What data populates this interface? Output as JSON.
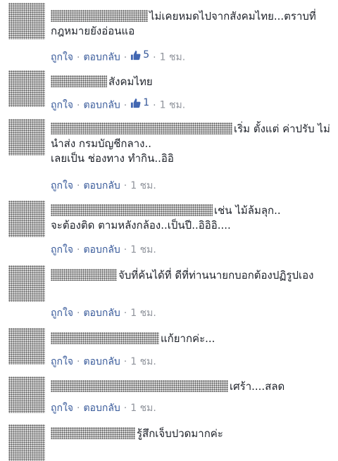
{
  "actions": {
    "like": "ถูกใจ",
    "reply": "ตอบกลับ",
    "separator": "·"
  },
  "comments": [
    {
      "text": "ไม่เคยหมดไปจากสังคมไทย...ตราบที่กฎหมายยังอ่อนแอ",
      "likes": "5",
      "time": "1 ชม."
    },
    {
      "text": "สังคมไทย",
      "likes": "1",
      "time": "1 ชม."
    },
    {
      "text": "เริ่ม ตั้งแต่ ค่าปรับ ไม่นำส่ง กรมบัญชีกลาง..\nเลยเป็น ช่องทาง ทำกิน..อิอิ",
      "likes": "",
      "time": "1 ชม."
    },
    {
      "text": "เช่น ไม้ล้มลุก..\nจะต้องติด ตามหลังกล้อง..เป็นปี..อิอิอิ....",
      "likes": "",
      "time": "1 ชม."
    },
    {
      "text": "จับที่ค้นได้ที่ ดีที่ท่านนายกบอกต้องปฏิรูปเอง",
      "likes": "",
      "time": "1 ชม."
    },
    {
      "text": "แก้ยากค่ะ...",
      "likes": "",
      "time": "1 ชม."
    },
    {
      "text": "เศร้า....สลด",
      "likes": "",
      "time": "1 ชม."
    },
    {
      "text": "รู้สึกเจ็บปวดมากค่ะ",
      "likes": "",
      "time": ""
    }
  ]
}
